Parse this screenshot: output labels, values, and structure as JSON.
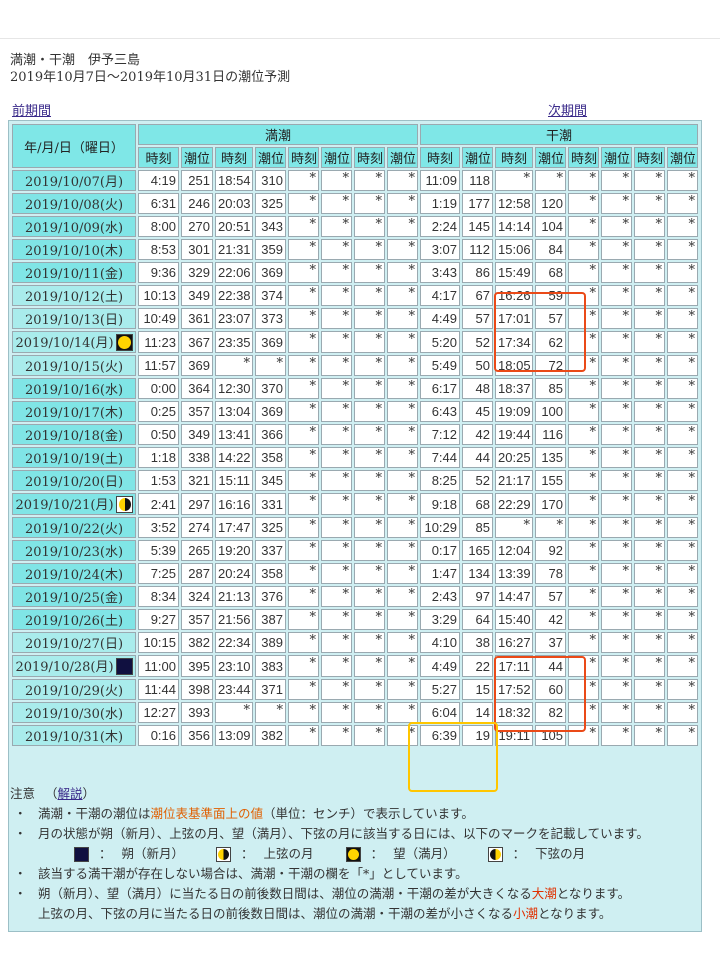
{
  "page": {
    "title_line1": "満潮・干潮　伊予三島",
    "title_line2": "2019年10月7日～2019年10月31日の潮位予測",
    "prev_link": "前期間",
    "next_link": "次期間"
  },
  "table": {
    "date_header": "年/月/日（曜日）",
    "high_header": "満潮",
    "low_header": "干潮",
    "sub_headers": [
      "時刻",
      "潮位",
      "時刻",
      "潮位",
      "時刻",
      "潮位",
      "時刻",
      "潮位"
    ],
    "rows": [
      {
        "date": "2019/10/07(月)",
        "moon": "",
        "high": [
          "4:19",
          "251",
          "18:54",
          "310",
          "*",
          "*",
          "*",
          "*"
        ],
        "low": [
          "11:09",
          "118",
          "*",
          "*",
          "*",
          "*",
          "*",
          "*"
        ]
      },
      {
        "date": "2019/10/08(火)",
        "moon": "",
        "high": [
          "6:31",
          "246",
          "20:03",
          "325",
          "*",
          "*",
          "*",
          "*"
        ],
        "low": [
          "1:19",
          "177",
          "12:58",
          "120",
          "*",
          "*",
          "*",
          "*"
        ]
      },
      {
        "date": "2019/10/09(水)",
        "moon": "",
        "high": [
          "8:00",
          "270",
          "20:51",
          "343",
          "*",
          "*",
          "*",
          "*"
        ],
        "low": [
          "2:24",
          "145",
          "14:14",
          "104",
          "*",
          "*",
          "*",
          "*"
        ]
      },
      {
        "date": "2019/10/10(木)",
        "moon": "",
        "high": [
          "8:53",
          "301",
          "21:31",
          "359",
          "*",
          "*",
          "*",
          "*"
        ],
        "low": [
          "3:07",
          "112",
          "15:06",
          "84",
          "*",
          "*",
          "*",
          "*"
        ]
      },
      {
        "date": "2019/10/11(金)",
        "moon": "",
        "high": [
          "9:36",
          "329",
          "22:06",
          "369",
          "*",
          "*",
          "*",
          "*"
        ],
        "low": [
          "3:43",
          "86",
          "15:49",
          "68",
          "*",
          "*",
          "*",
          "*"
        ]
      },
      {
        "date": "2019/10/12(土)",
        "moon": "",
        "high": [
          "10:13",
          "349",
          "22:38",
          "374",
          "*",
          "*",
          "*",
          "*"
        ],
        "low": [
          "4:17",
          "67",
          "16:26",
          "59",
          "*",
          "*",
          "*",
          "*"
        ]
      },
      {
        "date": "2019/10/13(日)",
        "moon": "",
        "high": [
          "10:49",
          "361",
          "23:07",
          "373",
          "*",
          "*",
          "*",
          "*"
        ],
        "low": [
          "4:49",
          "57",
          "17:01",
          "57",
          "*",
          "*",
          "*",
          "*"
        ]
      },
      {
        "date": "2019/10/14(月)",
        "moon": "full",
        "high": [
          "11:23",
          "367",
          "23:35",
          "369",
          "*",
          "*",
          "*",
          "*"
        ],
        "low": [
          "5:20",
          "52",
          "17:34",
          "62",
          "*",
          "*",
          "*",
          "*"
        ]
      },
      {
        "date": "2019/10/15(火)",
        "moon": "",
        "high": [
          "11:57",
          "369",
          "*",
          "*",
          "*",
          "*",
          "*",
          "*"
        ],
        "low": [
          "5:49",
          "50",
          "18:05",
          "72",
          "*",
          "*",
          "*",
          "*"
        ]
      },
      {
        "date": "2019/10/16(水)",
        "moon": "",
        "high": [
          "0:00",
          "364",
          "12:30",
          "370",
          "*",
          "*",
          "*",
          "*"
        ],
        "low": [
          "6:17",
          "48",
          "18:37",
          "85",
          "*",
          "*",
          "*",
          "*"
        ]
      },
      {
        "date": "2019/10/17(木)",
        "moon": "",
        "high": [
          "0:25",
          "357",
          "13:04",
          "369",
          "*",
          "*",
          "*",
          "*"
        ],
        "low": [
          "6:43",
          "45",
          "19:09",
          "100",
          "*",
          "*",
          "*",
          "*"
        ]
      },
      {
        "date": "2019/10/18(金)",
        "moon": "",
        "high": [
          "0:50",
          "349",
          "13:41",
          "366",
          "*",
          "*",
          "*",
          "*"
        ],
        "low": [
          "7:12",
          "42",
          "19:44",
          "116",
          "*",
          "*",
          "*",
          "*"
        ]
      },
      {
        "date": "2019/10/19(土)",
        "moon": "",
        "high": [
          "1:18",
          "338",
          "14:22",
          "358",
          "*",
          "*",
          "*",
          "*"
        ],
        "low": [
          "7:44",
          "44",
          "20:25",
          "135",
          "*",
          "*",
          "*",
          "*"
        ]
      },
      {
        "date": "2019/10/20(日)",
        "moon": "",
        "high": [
          "1:53",
          "321",
          "15:11",
          "345",
          "*",
          "*",
          "*",
          "*"
        ],
        "low": [
          "8:25",
          "52",
          "21:17",
          "155",
          "*",
          "*",
          "*",
          "*"
        ]
      },
      {
        "date": "2019/10/21(月)",
        "moon": "half",
        "high": [
          "2:41",
          "297",
          "16:16",
          "331",
          "*",
          "*",
          "*",
          "*"
        ],
        "low": [
          "9:18",
          "68",
          "22:29",
          "170",
          "*",
          "*",
          "*",
          "*"
        ]
      },
      {
        "date": "2019/10/22(火)",
        "moon": "",
        "high": [
          "3:52",
          "274",
          "17:47",
          "325",
          "*",
          "*",
          "*",
          "*"
        ],
        "low": [
          "10:29",
          "85",
          "*",
          "*",
          "*",
          "*",
          "*",
          "*"
        ]
      },
      {
        "date": "2019/10/23(水)",
        "moon": "",
        "high": [
          "5:39",
          "265",
          "19:20",
          "337",
          "*",
          "*",
          "*",
          "*"
        ],
        "low": [
          "0:17",
          "165",
          "12:04",
          "92",
          "*",
          "*",
          "*",
          "*"
        ]
      },
      {
        "date": "2019/10/24(木)",
        "moon": "",
        "high": [
          "7:25",
          "287",
          "20:24",
          "358",
          "*",
          "*",
          "*",
          "*"
        ],
        "low": [
          "1:47",
          "134",
          "13:39",
          "78",
          "*",
          "*",
          "*",
          "*"
        ]
      },
      {
        "date": "2019/10/25(金)",
        "moon": "",
        "high": [
          "8:34",
          "324",
          "21:13",
          "376",
          "*",
          "*",
          "*",
          "*"
        ],
        "low": [
          "2:43",
          "97",
          "14:47",
          "57",
          "*",
          "*",
          "*",
          "*"
        ]
      },
      {
        "date": "2019/10/26(土)",
        "moon": "",
        "high": [
          "9:27",
          "357",
          "21:56",
          "387",
          "*",
          "*",
          "*",
          "*"
        ],
        "low": [
          "3:29",
          "64",
          "15:40",
          "42",
          "*",
          "*",
          "*",
          "*"
        ]
      },
      {
        "date": "2019/10/27(日)",
        "moon": "",
        "high": [
          "10:15",
          "382",
          "22:34",
          "389",
          "*",
          "*",
          "*",
          "*"
        ],
        "low": [
          "4:10",
          "38",
          "16:27",
          "37",
          "*",
          "*",
          "*",
          "*"
        ]
      },
      {
        "date": "2019/10/28(月)",
        "moon": "new",
        "high": [
          "11:00",
          "395",
          "23:10",
          "383",
          "*",
          "*",
          "*",
          "*"
        ],
        "low": [
          "4:49",
          "22",
          "17:11",
          "44",
          "*",
          "*",
          "*",
          "*"
        ]
      },
      {
        "date": "2019/10/29(火)",
        "moon": "",
        "high": [
          "11:44",
          "398",
          "23:44",
          "371",
          "*",
          "*",
          "*",
          "*"
        ],
        "low": [
          "5:27",
          "15",
          "17:52",
          "60",
          "*",
          "*",
          "*",
          "*"
        ]
      },
      {
        "date": "2019/10/30(水)",
        "moon": "",
        "high": [
          "12:27",
          "393",
          "*",
          "*",
          "*",
          "*",
          "*",
          "*"
        ],
        "low": [
          "6:04",
          "14",
          "18:32",
          "82",
          "*",
          "*",
          "*",
          "*"
        ]
      },
      {
        "date": "2019/10/31(木)",
        "moon": "",
        "high": [
          "0:16",
          "356",
          "13:09",
          "382",
          "*",
          "*",
          "*",
          "*"
        ],
        "low": [
          "6:39",
          "19",
          "19:11",
          "105",
          "*",
          "*",
          "*",
          "*"
        ]
      }
    ]
  },
  "notes": {
    "label": "注意",
    "explain_link": "解説",
    "paren_open": "（",
    "paren_close": "）",
    "bullet": "・",
    "line1_pre": "満潮・干潮の潮位は",
    "line1_em": "潮位表基準面上の値",
    "line1_post": "（単位：センチ）で表示しています。",
    "line2": "月の状態が朔（新月）、上弦の月、望（満月）、下弦の月に該当する日には、以下のマークを記載しています。",
    "legend": [
      {
        "kind": "new",
        "sep": "：",
        "label": "朔（新月）"
      },
      {
        "kind": "first",
        "sep": "：",
        "label": "上弦の月"
      },
      {
        "kind": "full",
        "sep": "：",
        "label": "望（満月）"
      },
      {
        "kind": "last",
        "sep": "：",
        "label": "下弦の月"
      }
    ],
    "line3": "該当する満干潮が存在しない場合は、満潮・干潮の欄を「*」としています。",
    "line4_pre": "朔（新月）、望（満月）に当たる日の前後数日間は、潮位の満潮・干潮の差が大きくなる",
    "line4_em": "大潮",
    "line4_post": "となります。",
    "line5_pre": "上弦の月、下弦の月に当たる日の前後数日間は、潮位の満潮・干潮の差が小さくなる",
    "line5_em": "小潮",
    "line5_post": "となります。"
  },
  "colors": {
    "header_bg": "#7fe7e7",
    "date_bg": "#80e5e6",
    "frame_bg": "#cfeff2",
    "highlight_red": "#ea4a18",
    "highlight_yellow": "#ffc600",
    "emphasis_orange": "#e05f00"
  }
}
